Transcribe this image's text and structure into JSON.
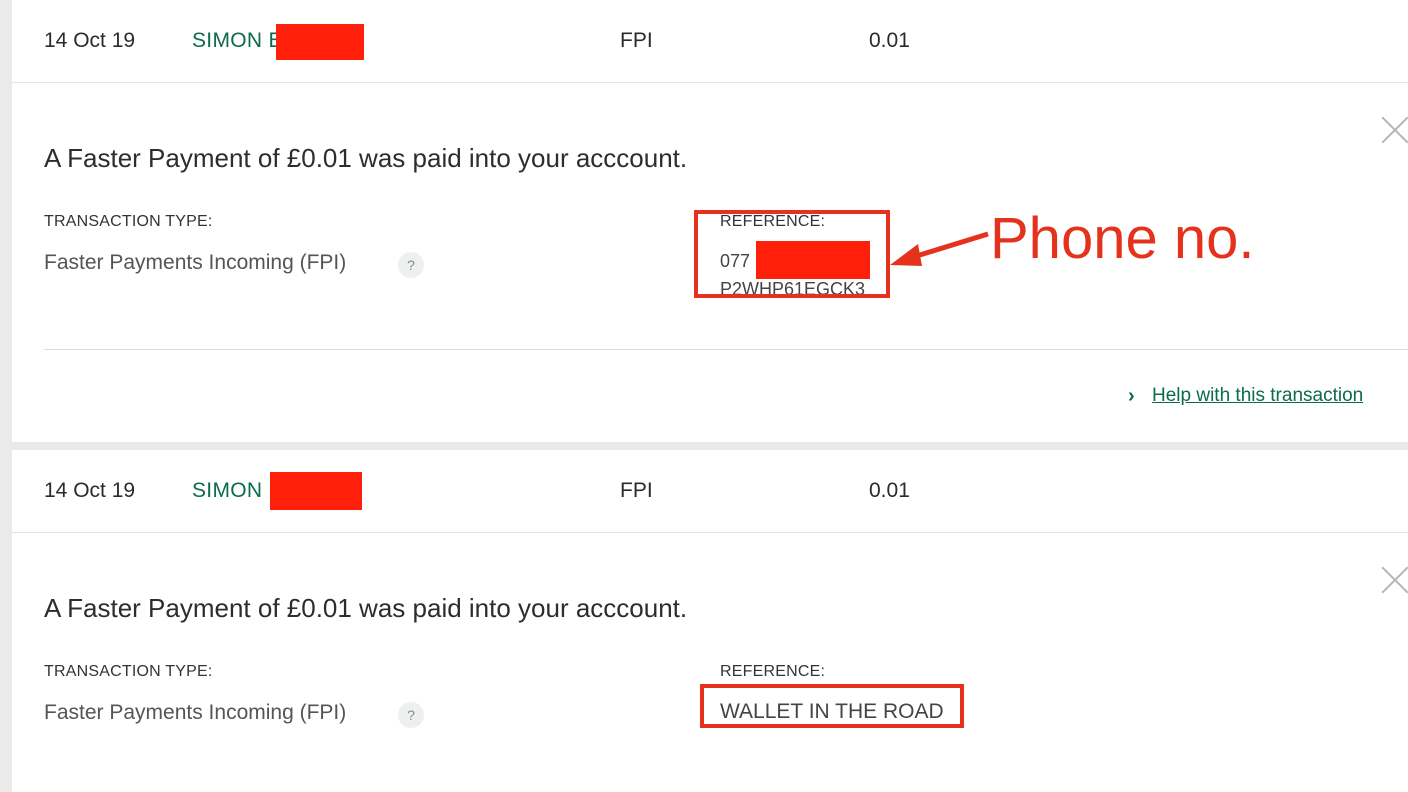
{
  "transactions": [
    {
      "date": "14 Oct 19",
      "name": "SIMON E",
      "type_code": "FPI",
      "amount": "0.01",
      "headline": "A Faster Payment of £0.01 was paid into your acccount.",
      "type_label": "TRANSACTION TYPE:",
      "type_value": "Faster Payments Incoming (FPI)",
      "help_icon": "?",
      "reference_label": "REFERENCE:",
      "reference_lines": [
        "077",
        "P2WHP61EGCK3"
      ],
      "help_link": "Help with this transaction"
    },
    {
      "date": "14 Oct 19",
      "name": "SIMON",
      "type_code": "FPI",
      "amount": "0.01",
      "headline": "A Faster Payment of £0.01 was paid into your acccount.",
      "type_label": "TRANSACTION TYPE:",
      "type_value": "Faster Payments Incoming (FPI)",
      "help_icon": "?",
      "reference_label": "REFERENCE:",
      "reference_lines": [
        "WALLET IN THE ROAD"
      ]
    }
  ],
  "annotation": {
    "label": "Phone no.",
    "color": "#e5321d"
  },
  "colors": {
    "accent_green": "#0c6b4a",
    "redaction": "#ff1f0a"
  },
  "icons": {
    "close": "close-icon",
    "chevron": "chevron-right-icon",
    "help": "question-icon"
  }
}
